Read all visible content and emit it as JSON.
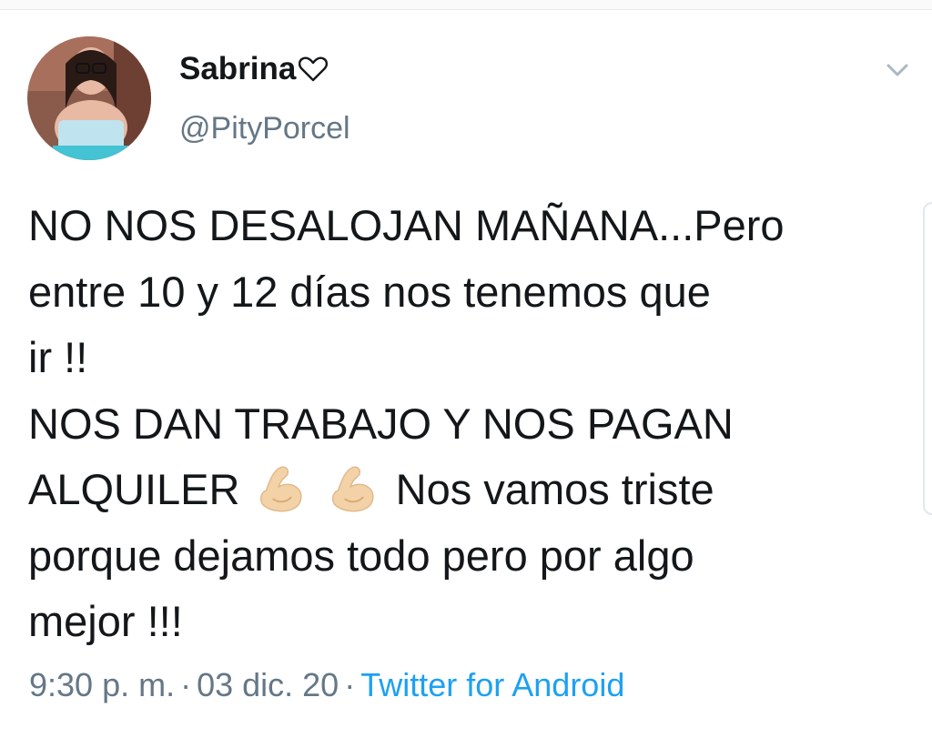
{
  "author": {
    "display_name": "Sabrina",
    "handle": "@PityPorcel",
    "avatar_icon": "profile-photo",
    "name_suffix_icon": "white-heart-icon"
  },
  "tweet": {
    "lines": [
      "NO NOS DESALOJAN MAÑANA...Pero",
      "entre 10 y 12 días nos tenemos que",
      "ir !!",
      "NOS DAN TRABAJO Y NOS PAGAN",
      "ALQUILER",
      "Nos vamos triste",
      "porque dejamos todo pero por algo",
      "mejor !!!"
    ],
    "emoji": [
      "flexed-biceps",
      "flexed-biceps"
    ]
  },
  "meta": {
    "time": "9:30 p. m.",
    "separator": "·",
    "date": "03 dic. 20",
    "source": "Twitter for Android"
  },
  "colors": {
    "text": "#14171a",
    "muted": "#657786",
    "link": "#1da1f2",
    "emoji_skin": "#f3d2a8"
  }
}
